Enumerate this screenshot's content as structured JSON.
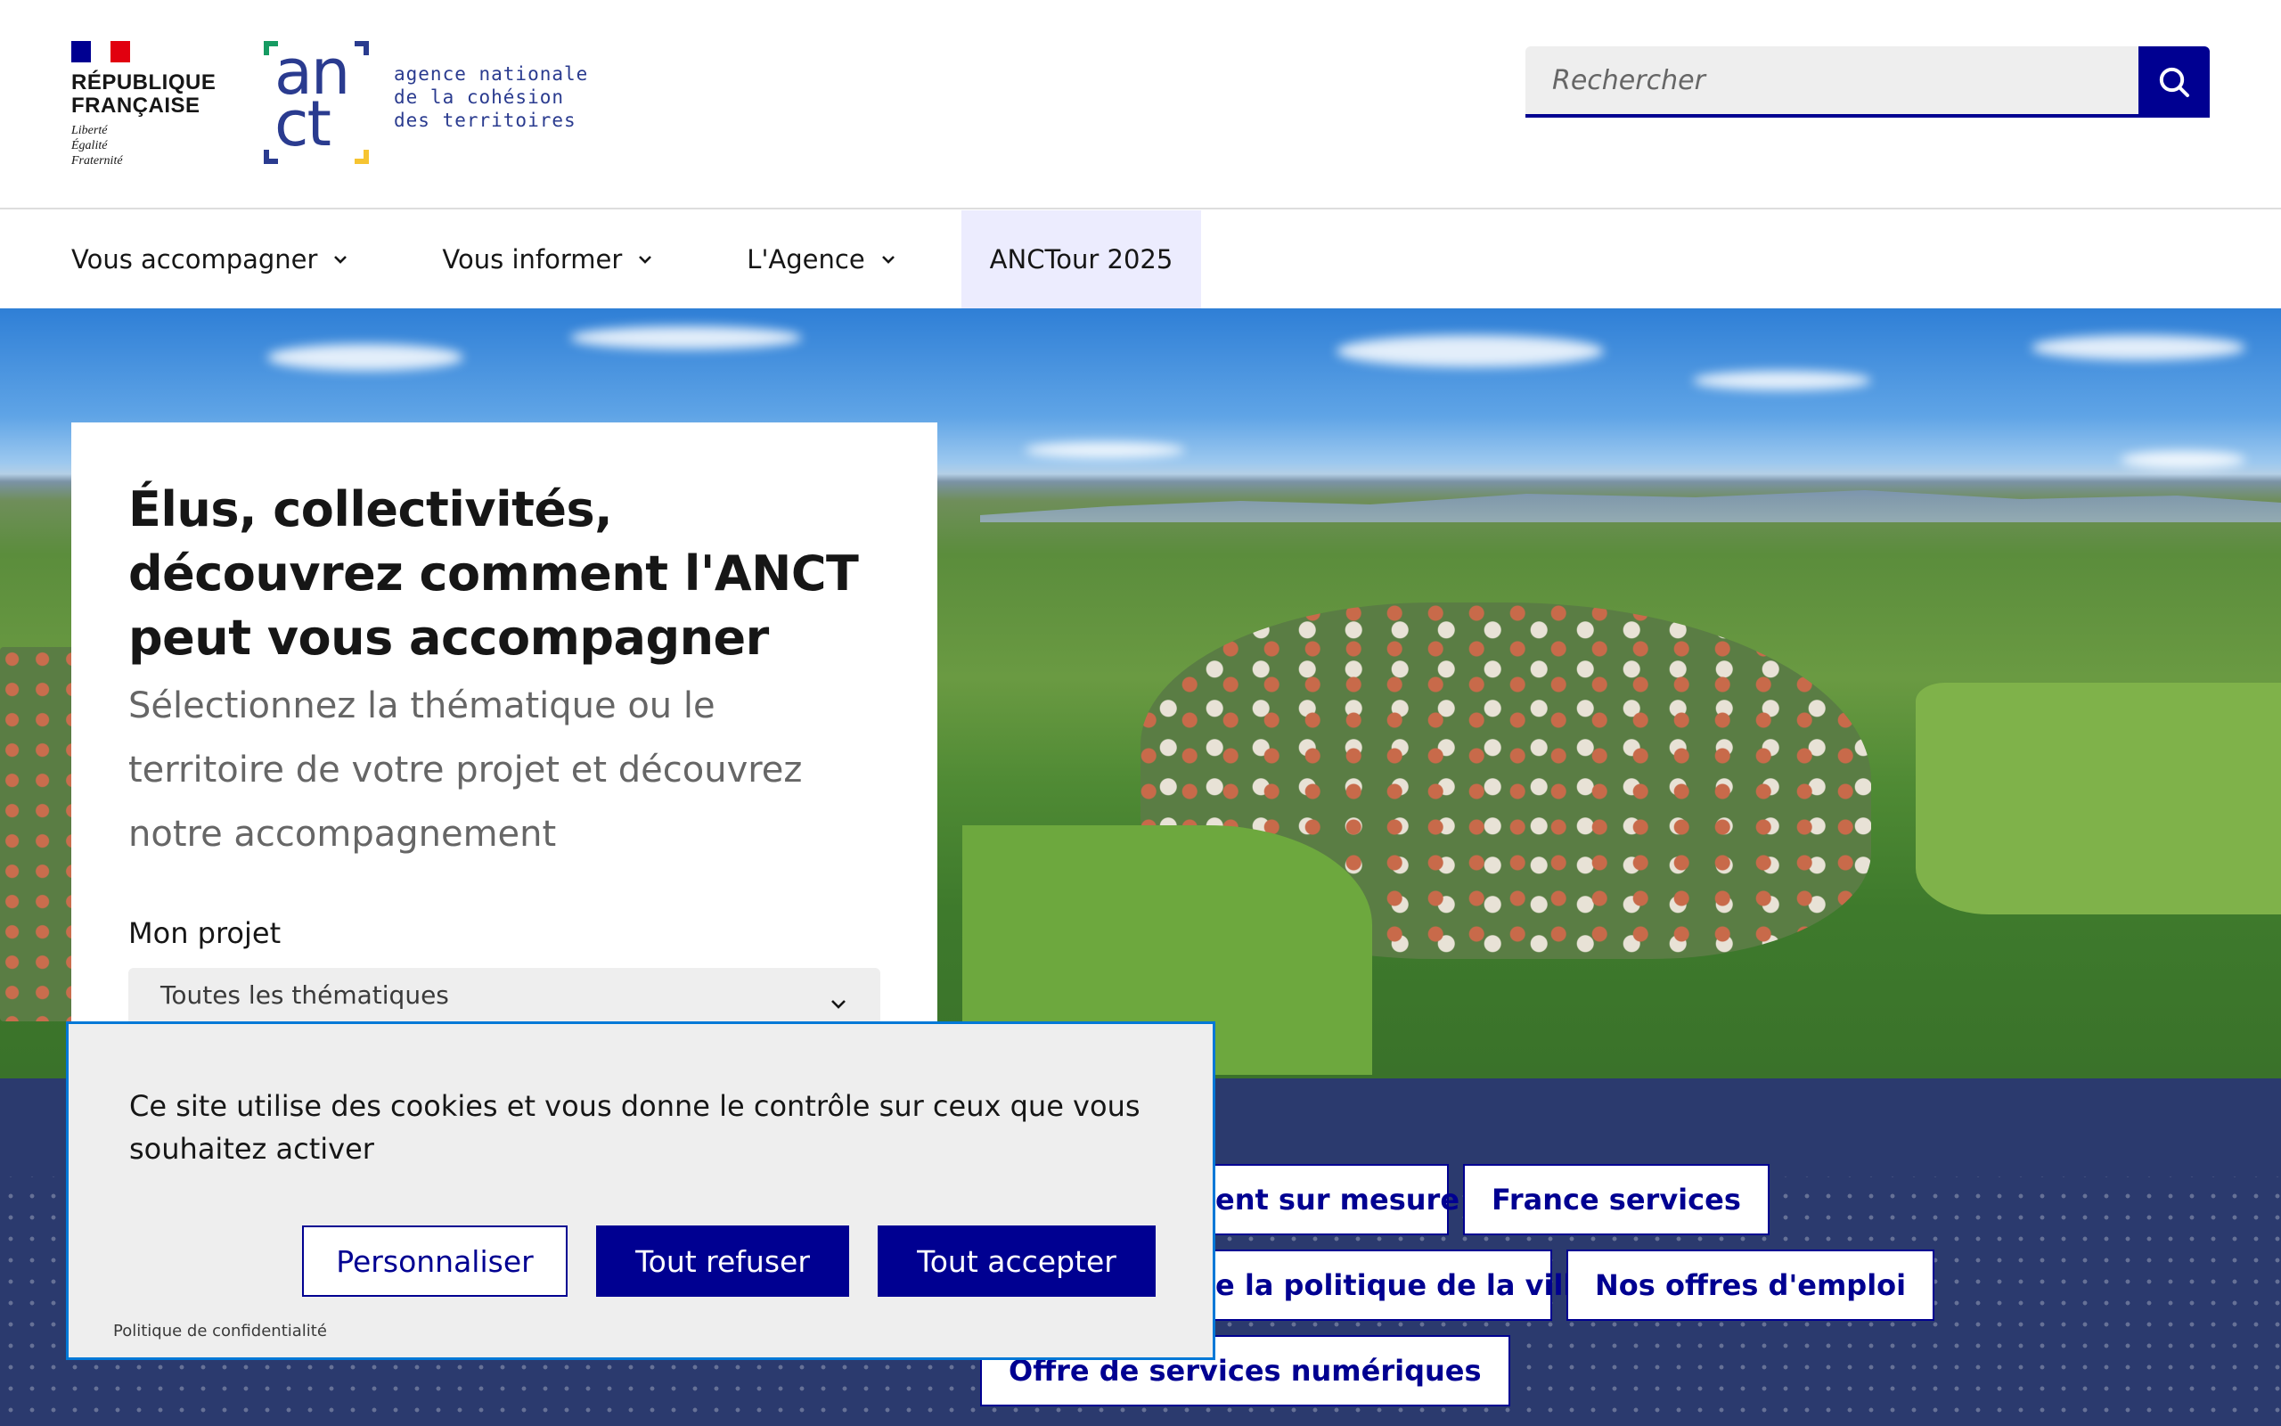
{
  "header": {
    "republique_line1": "RÉPUBLIQUE",
    "republique_line2": "FRANÇAISE",
    "motto_1": "Liberté",
    "motto_2": "Égalité",
    "motto_3": "Fraternité",
    "logo_letters_1": "an",
    "logo_letters_2": "ct",
    "tagline_1": "agence nationale",
    "tagline_2": "de la cohésion",
    "tagline_3": "des territoires",
    "search_placeholder": "Rechercher",
    "colors": {
      "flag_blue": "#000091",
      "flag_red": "#e1000f",
      "brand_blue": "#2a3b8f",
      "green": "#169b62",
      "yellow": "#f6c431"
    }
  },
  "nav": {
    "items": [
      {
        "label": "Vous accompagner",
        "has_dropdown": true
      },
      {
        "label": "Vous informer",
        "has_dropdown": true
      },
      {
        "label": "L'Agence",
        "has_dropdown": true
      },
      {
        "label": "ANCTour 2025",
        "has_dropdown": false,
        "active": true
      }
    ]
  },
  "hero": {
    "title": "Élus, collectivités, découvrez comment l'ANCT peut vous accompagner",
    "subtitle": "Sélectionnez la thématique ou le territoire de votre projet et découvrez notre accompagnement",
    "project_label": "Mon projet",
    "project_select_value": "Toutes les thématiques"
  },
  "tags": [
    "…ent sur mesure",
    "France services",
    "…e la politique de la ville",
    "Nos offres d'emploi",
    "Offre de services numériques"
  ],
  "cookie": {
    "message": "Ce site utilise des cookies et vous donne le contrôle sur ceux que vous souhaitez activer",
    "customize_label": "Personnaliser",
    "refuse_label": "Tout refuser",
    "accept_label": "Tout accepter",
    "policy_link": "Politique de confidentialité"
  }
}
